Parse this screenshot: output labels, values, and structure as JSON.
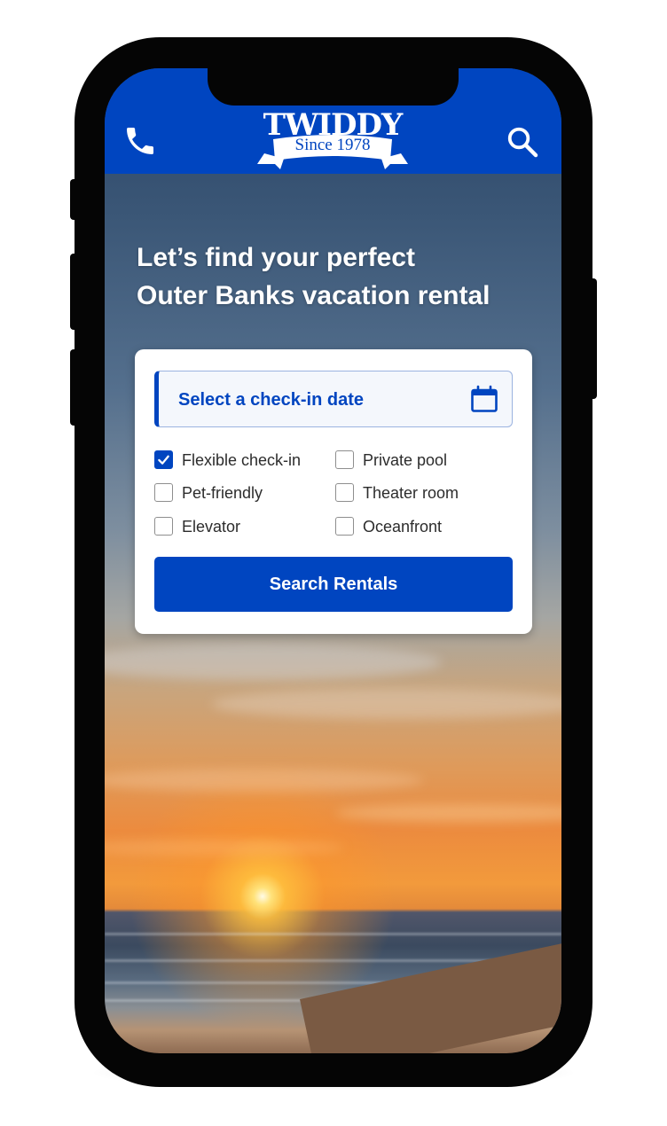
{
  "header": {
    "logo_word": "TWIDDY",
    "logo_tagline": "Since 1978",
    "brand_color": "#0045c0",
    "icons": [
      "phone-icon",
      "search-icon"
    ]
  },
  "hero": {
    "headline_line1": "Let’s find your perfect",
    "headline_line2": "Outer Banks vacation rental"
  },
  "search_card": {
    "date_placeholder": "Select a check-in date",
    "date_icon": "calendar-icon",
    "options": [
      {
        "label": "Flexible check-in",
        "checked": true
      },
      {
        "label": "Pet-friendly",
        "checked": false
      },
      {
        "label": "Elevator",
        "checked": false
      },
      {
        "label": "Private pool",
        "checked": false
      },
      {
        "label": "Theater room",
        "checked": false
      },
      {
        "label": "Oceanfront",
        "checked": false
      }
    ],
    "submit_label": "Search Rentals"
  }
}
